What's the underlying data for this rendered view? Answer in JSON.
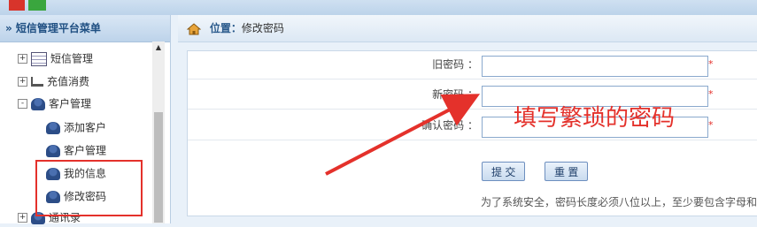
{
  "sidebar": {
    "title": "» 短信管理平台菜单",
    "items": [
      {
        "label": "短信管理",
        "toggle": "+",
        "icon": "grid-icon"
      },
      {
        "label": "充值消费",
        "toggle": "+",
        "icon": "cart-icon"
      },
      {
        "label": "客户管理",
        "toggle": "-",
        "icon": "users-icon"
      },
      {
        "label": "添加客户",
        "icon": "user-icon"
      },
      {
        "label": "客户管理",
        "icon": "user-icon"
      },
      {
        "label": "我的信息",
        "icon": "user-icon"
      },
      {
        "label": "修改密码",
        "icon": "user-icon"
      },
      {
        "label": "通讯录",
        "toggle": "+",
        "icon": "contacts-icon"
      }
    ]
  },
  "breadcrumb": {
    "prefix": "位置：",
    "current": "修改密码"
  },
  "form": {
    "old_password_label": "旧密码 ：",
    "new_password_label": "新密码 ：",
    "confirm_password_label": "确认密码 ：",
    "required_mark": "*",
    "submit_label": "提 交",
    "reset_label": "重 置",
    "note": "为了系统安全，密码长度必须八位以上，至少要包含字母和"
  },
  "annotation": {
    "text": "填写繁琐的密码"
  },
  "colors": {
    "annotation": "#e4312b",
    "sidebar_header": "#1f4f82"
  }
}
